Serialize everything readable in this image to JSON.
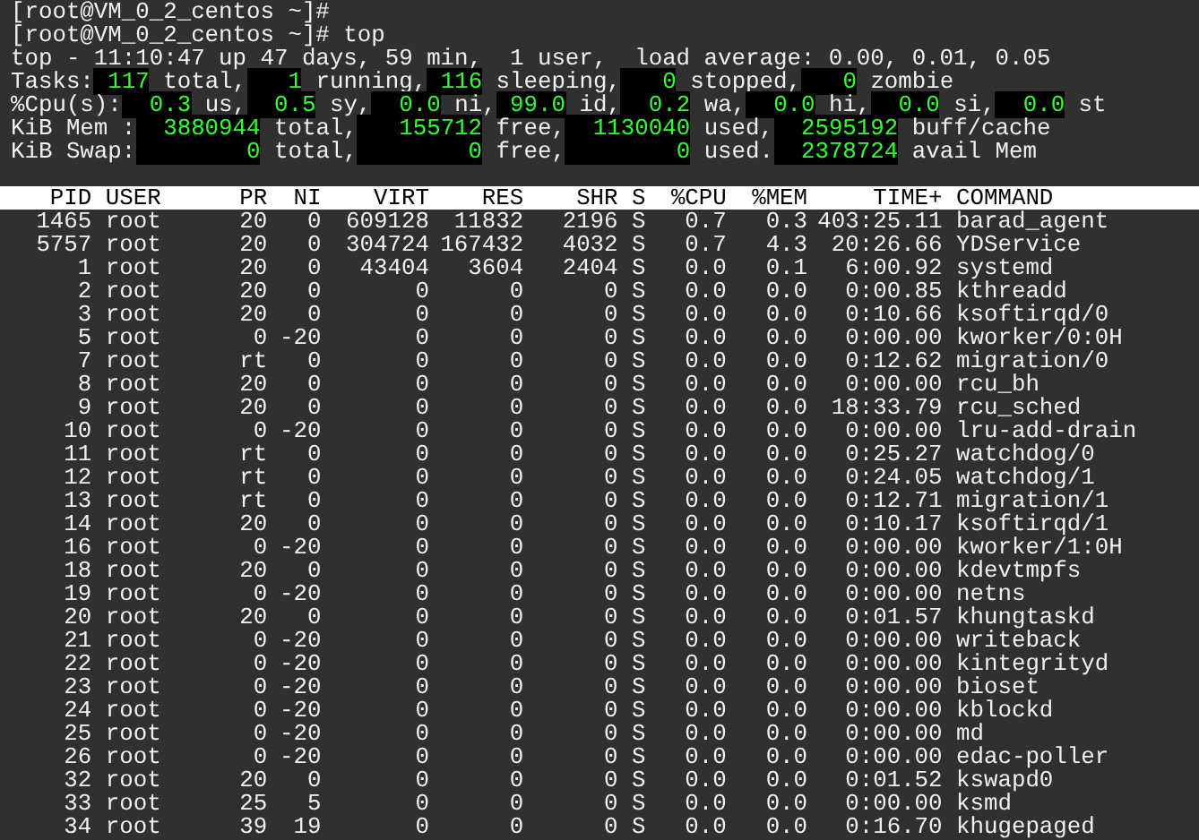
{
  "prompts": [
    "[root@VM_0_2_centos ~]#",
    "[root@VM_0_2_centos ~]# top"
  ],
  "summary": [
    [
      {
        "kind": "label",
        "text": "top - 11:10:47 up 47 days, 59 min,  1 user,  load average: 0.00, 0.01, 0.05"
      }
    ],
    [
      {
        "kind": "label",
        "text": "Tasks:"
      },
      {
        "kind": "value",
        "text": " 117"
      },
      {
        "kind": "label",
        "text": " total,"
      },
      {
        "kind": "value",
        "text": "   1"
      },
      {
        "kind": "label",
        "text": " running,"
      },
      {
        "kind": "value",
        "text": " 116"
      },
      {
        "kind": "label",
        "text": " sleeping,"
      },
      {
        "kind": "value",
        "text": "   0"
      },
      {
        "kind": "label",
        "text": " stopped,"
      },
      {
        "kind": "value",
        "text": "   0"
      },
      {
        "kind": "label",
        "text": " zombie"
      }
    ],
    [
      {
        "kind": "label",
        "text": "%Cpu(s):"
      },
      {
        "kind": "value",
        "text": "  0.3"
      },
      {
        "kind": "label",
        "text": " us,"
      },
      {
        "kind": "value",
        "text": "  0.5"
      },
      {
        "kind": "label",
        "text": " sy,"
      },
      {
        "kind": "value",
        "text": "  0.0"
      },
      {
        "kind": "label",
        "text": " ni,"
      },
      {
        "kind": "value",
        "text": " 99.0"
      },
      {
        "kind": "label",
        "text": " id,"
      },
      {
        "kind": "value",
        "text": "  0.2"
      },
      {
        "kind": "label",
        "text": " wa,"
      },
      {
        "kind": "value",
        "text": "  0.0"
      },
      {
        "kind": "label",
        "text": " hi,"
      },
      {
        "kind": "value",
        "text": "  0.0"
      },
      {
        "kind": "label",
        "text": " si,"
      },
      {
        "kind": "value",
        "text": "  0.0"
      },
      {
        "kind": "label",
        "text": " st"
      }
    ],
    [
      {
        "kind": "label",
        "text": "KiB Mem :"
      },
      {
        "kind": "value",
        "text": "  3880944"
      },
      {
        "kind": "label",
        "text": " total,"
      },
      {
        "kind": "value",
        "text": "   155712"
      },
      {
        "kind": "label",
        "text": " free,"
      },
      {
        "kind": "value",
        "text": "  1130040"
      },
      {
        "kind": "label",
        "text": " used,"
      },
      {
        "kind": "value",
        "text": "  2595192"
      },
      {
        "kind": "label",
        "text": " buff/cache"
      }
    ],
    [
      {
        "kind": "label",
        "text": "KiB Swap:"
      },
      {
        "kind": "value",
        "text": "        0"
      },
      {
        "kind": "label",
        "text": " total,"
      },
      {
        "kind": "value",
        "text": "        0"
      },
      {
        "kind": "label",
        "text": " free,"
      },
      {
        "kind": "value",
        "text": "        0"
      },
      {
        "kind": "label",
        "text": " used."
      },
      {
        "kind": "value",
        "text": "  2378724"
      },
      {
        "kind": "label",
        "text": " avail Mem"
      }
    ]
  ],
  "table": {
    "columns": [
      "PID",
      "USER",
      "PR",
      "NI",
      "VIRT",
      "RES",
      "SHR",
      "S",
      "%CPU",
      "%MEM",
      "TIME+",
      "COMMAND"
    ],
    "rows": [
      [
        "1465",
        "root",
        "20",
        "0",
        "609128",
        "11832",
        "2196",
        "S",
        "0.7",
        "0.3",
        "403:25.11",
        "barad_agent"
      ],
      [
        "5757",
        "root",
        "20",
        "0",
        "304724",
        "167432",
        "4032",
        "S",
        "0.7",
        "4.3",
        "20:26.66",
        "YDService"
      ],
      [
        "1",
        "root",
        "20",
        "0",
        "43404",
        "3604",
        "2404",
        "S",
        "0.0",
        "0.1",
        "6:00.92",
        "systemd"
      ],
      [
        "2",
        "root",
        "20",
        "0",
        "0",
        "0",
        "0",
        "S",
        "0.0",
        "0.0",
        "0:00.85",
        "kthreadd"
      ],
      [
        "3",
        "root",
        "20",
        "0",
        "0",
        "0",
        "0",
        "S",
        "0.0",
        "0.0",
        "0:10.66",
        "ksoftirqd/0"
      ],
      [
        "5",
        "root",
        "0",
        "-20",
        "0",
        "0",
        "0",
        "S",
        "0.0",
        "0.0",
        "0:00.00",
        "kworker/0:0H"
      ],
      [
        "7",
        "root",
        "rt",
        "0",
        "0",
        "0",
        "0",
        "S",
        "0.0",
        "0.0",
        "0:12.62",
        "migration/0"
      ],
      [
        "8",
        "root",
        "20",
        "0",
        "0",
        "0",
        "0",
        "S",
        "0.0",
        "0.0",
        "0:00.00",
        "rcu_bh"
      ],
      [
        "9",
        "root",
        "20",
        "0",
        "0",
        "0",
        "0",
        "S",
        "0.0",
        "0.0",
        "18:33.79",
        "rcu_sched"
      ],
      [
        "10",
        "root",
        "0",
        "-20",
        "0",
        "0",
        "0",
        "S",
        "0.0",
        "0.0",
        "0:00.00",
        "lru-add-drain"
      ],
      [
        "11",
        "root",
        "rt",
        "0",
        "0",
        "0",
        "0",
        "S",
        "0.0",
        "0.0",
        "0:25.27",
        "watchdog/0"
      ],
      [
        "12",
        "root",
        "rt",
        "0",
        "0",
        "0",
        "0",
        "S",
        "0.0",
        "0.0",
        "0:24.05",
        "watchdog/1"
      ],
      [
        "13",
        "root",
        "rt",
        "0",
        "0",
        "0",
        "0",
        "S",
        "0.0",
        "0.0",
        "0:12.71",
        "migration/1"
      ],
      [
        "14",
        "root",
        "20",
        "0",
        "0",
        "0",
        "0",
        "S",
        "0.0",
        "0.0",
        "0:10.17",
        "ksoftirqd/1"
      ],
      [
        "16",
        "root",
        "0",
        "-20",
        "0",
        "0",
        "0",
        "S",
        "0.0",
        "0.0",
        "0:00.00",
        "kworker/1:0H"
      ],
      [
        "18",
        "root",
        "20",
        "0",
        "0",
        "0",
        "0",
        "S",
        "0.0",
        "0.0",
        "0:00.00",
        "kdevtmpfs"
      ],
      [
        "19",
        "root",
        "0",
        "-20",
        "0",
        "0",
        "0",
        "S",
        "0.0",
        "0.0",
        "0:00.00",
        "netns"
      ],
      [
        "20",
        "root",
        "20",
        "0",
        "0",
        "0",
        "0",
        "S",
        "0.0",
        "0.0",
        "0:01.57",
        "khungtaskd"
      ],
      [
        "21",
        "root",
        "0",
        "-20",
        "0",
        "0",
        "0",
        "S",
        "0.0",
        "0.0",
        "0:00.00",
        "writeback"
      ],
      [
        "22",
        "root",
        "0",
        "-20",
        "0",
        "0",
        "0",
        "S",
        "0.0",
        "0.0",
        "0:00.00",
        "kintegrityd"
      ],
      [
        "23",
        "root",
        "0",
        "-20",
        "0",
        "0",
        "0",
        "S",
        "0.0",
        "0.0",
        "0:00.00",
        "bioset"
      ],
      [
        "24",
        "root",
        "0",
        "-20",
        "0",
        "0",
        "0",
        "S",
        "0.0",
        "0.0",
        "0:00.00",
        "kblockd"
      ],
      [
        "25",
        "root",
        "0",
        "-20",
        "0",
        "0",
        "0",
        "S",
        "0.0",
        "0.0",
        "0:00.00",
        "md"
      ],
      [
        "26",
        "root",
        "0",
        "-20",
        "0",
        "0",
        "0",
        "S",
        "0.0",
        "0.0",
        "0:00.00",
        "edac-poller"
      ],
      [
        "32",
        "root",
        "20",
        "0",
        "0",
        "0",
        "0",
        "S",
        "0.0",
        "0.0",
        "0:01.52",
        "kswapd0"
      ],
      [
        "33",
        "root",
        "25",
        "5",
        "0",
        "0",
        "0",
        "S",
        "0.0",
        "0.0",
        "0:00.00",
        "ksmd"
      ],
      [
        "34",
        "root",
        "39",
        "19",
        "0",
        "0",
        "0",
        "S",
        "0.0",
        "0.0",
        "0:16.70",
        "khugepaged"
      ]
    ]
  }
}
